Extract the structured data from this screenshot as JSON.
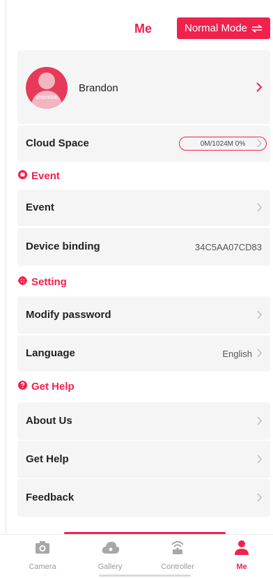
{
  "header": {
    "title": "Me",
    "mode_label": "Normal Mode"
  },
  "profile": {
    "username": "Brandon",
    "avatar_brand": "chacktok"
  },
  "cloud": {
    "label": "Cloud Space",
    "usage": "0M/1024M 0%"
  },
  "sections": {
    "event": "Event",
    "setting": "Setting",
    "help": "Get Help"
  },
  "rows": {
    "event": "Event",
    "device_binding": "Device binding",
    "device_id": "34C5AA07CD83",
    "modify_password": "Modify password",
    "language": "Language",
    "language_value": "English",
    "about_us": "About Us",
    "get_help": "Get Help",
    "feedback": "Feedback"
  },
  "nav": [
    {
      "label": "Camera",
      "icon": "camera-icon"
    },
    {
      "label": "Gallery",
      "icon": "cloud-icon"
    },
    {
      "label": "Controller",
      "icon": "controller-icon"
    },
    {
      "label": "Me",
      "icon": "person-icon"
    }
  ],
  "colors": {
    "accent": "#f0224d",
    "card_bg": "#f5f5f5"
  }
}
